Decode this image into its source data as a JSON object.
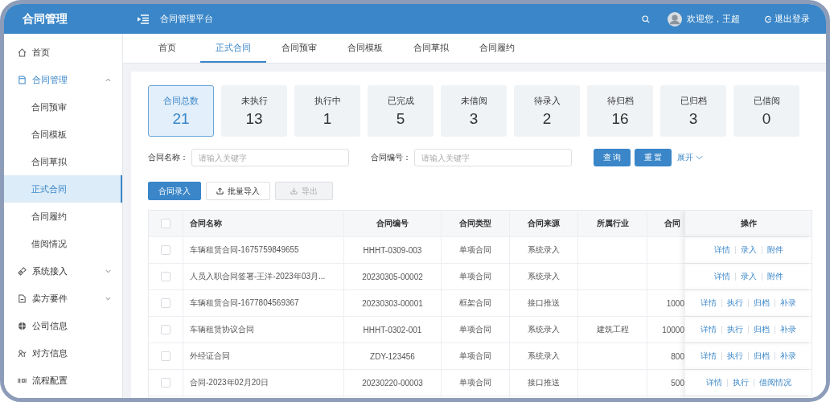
{
  "header": {
    "app_title": "合同管理",
    "platform_title": "合同管理平台",
    "welcome": "欢迎您，王超",
    "logout": "退出登录"
  },
  "sidebar": {
    "items": [
      {
        "label": "首页",
        "selected": false
      },
      {
        "label": "合同管理",
        "selected": true,
        "expanded": true,
        "children": [
          {
            "label": "合同预审",
            "selected": false
          },
          {
            "label": "合同模板",
            "selected": false
          },
          {
            "label": "合同草拟",
            "selected": false
          },
          {
            "label": "正式合同",
            "selected": true
          },
          {
            "label": "合同履约",
            "selected": false
          },
          {
            "label": "借阅情况",
            "selected": false
          }
        ]
      },
      {
        "label": "系统接入",
        "selected": false,
        "expanded": false
      },
      {
        "label": "卖方要件",
        "selected": false,
        "expanded": false
      },
      {
        "label": "公司信息",
        "selected": false
      },
      {
        "label": "对方信息",
        "selected": false
      },
      {
        "label": "流程配置",
        "selected": false
      }
    ]
  },
  "tabs": [
    {
      "label": "首页",
      "selected": false
    },
    {
      "label": "正式合同",
      "selected": true
    },
    {
      "label": "合同预审",
      "selected": false
    },
    {
      "label": "合同模板",
      "selected": false
    },
    {
      "label": "合同草拟",
      "selected": false
    },
    {
      "label": "合同履约",
      "selected": false
    }
  ],
  "stats": [
    {
      "label": "合同总数",
      "value": "21",
      "selected": true
    },
    {
      "label": "未执行",
      "value": "13",
      "selected": false
    },
    {
      "label": "执行中",
      "value": "1",
      "selected": false
    },
    {
      "label": "已完成",
      "value": "5",
      "selected": false
    },
    {
      "label": "未借阅",
      "value": "3",
      "selected": false
    },
    {
      "label": "待录入",
      "value": "2",
      "selected": false
    },
    {
      "label": "待归档",
      "value": "16",
      "selected": false
    },
    {
      "label": "已归档",
      "value": "3",
      "selected": false
    },
    {
      "label": "已借阅",
      "value": "0",
      "selected": false
    }
  ],
  "filters": [
    {
      "label": "合同名称：",
      "placeholder": "请输入关键字"
    },
    {
      "label": "合同编号：",
      "placeholder": "请输入关键字"
    }
  ],
  "filter_buttons": [
    "查 询",
    "重 置"
  ],
  "expand_link": "展开",
  "actions": [
    {
      "kind": "primary",
      "label": "合同录入",
      "disabled": false
    },
    {
      "kind": "upload",
      "label": "批量导入",
      "disabled": false
    },
    {
      "kind": "download",
      "label": "导出",
      "disabled": true
    }
  ],
  "table": {
    "select_all_checked": false,
    "columns": [
      "合同名称",
      "合同编号",
      "合同类型",
      "合同来源",
      "所属行业",
      "合同",
      "操作"
    ],
    "rows": [
      {
        "checked": false,
        "name": "车辆租赁合同-1675759849655",
        "code": "HHHT-0309-003",
        "type": "单项合同",
        "source": "系统录入",
        "ops": [
          "详情",
          "录入",
          "附件"
        ]
      },
      {
        "checked": false,
        "name": "人员入职合同签署-王洋-2023年03月...",
        "code": "20230305-00002",
        "type": "单项合同",
        "source": "系统录入",
        "ops": [
          "详情",
          "录入",
          "附件"
        ]
      },
      {
        "checked": false,
        "name": "车辆租赁合同-1677804569367",
        "code": "20230303-00001",
        "type": "框架合同",
        "source": "接口推送",
        "amount": "1000",
        "ops": [
          "详情",
          "执行",
          "归档",
          "补录"
        ]
      },
      {
        "checked": false,
        "name": "车辆租赁协议合同",
        "code": "HHHT-0302-001",
        "type": "单项合同",
        "source": "系统录入",
        "industry": "建筑工程",
        "amount": "10000",
        "ops": [
          "详情",
          "执行",
          "归档",
          "补录"
        ]
      },
      {
        "checked": false,
        "name": "外经证合同",
        "code": "ZDY-123456",
        "type": "单项合同",
        "source": "系统录入",
        "amount": "800",
        "ops": [
          "详情",
          "执行",
          "归档",
          "补录"
        ]
      },
      {
        "checked": false,
        "name": "合同-2023年02月20日",
        "code": "20230220-00003",
        "type": "单项合同",
        "source": "接口推送",
        "amount": "500",
        "ops": [
          "详情",
          "执行",
          "借阅情况"
        ]
      }
    ]
  }
}
